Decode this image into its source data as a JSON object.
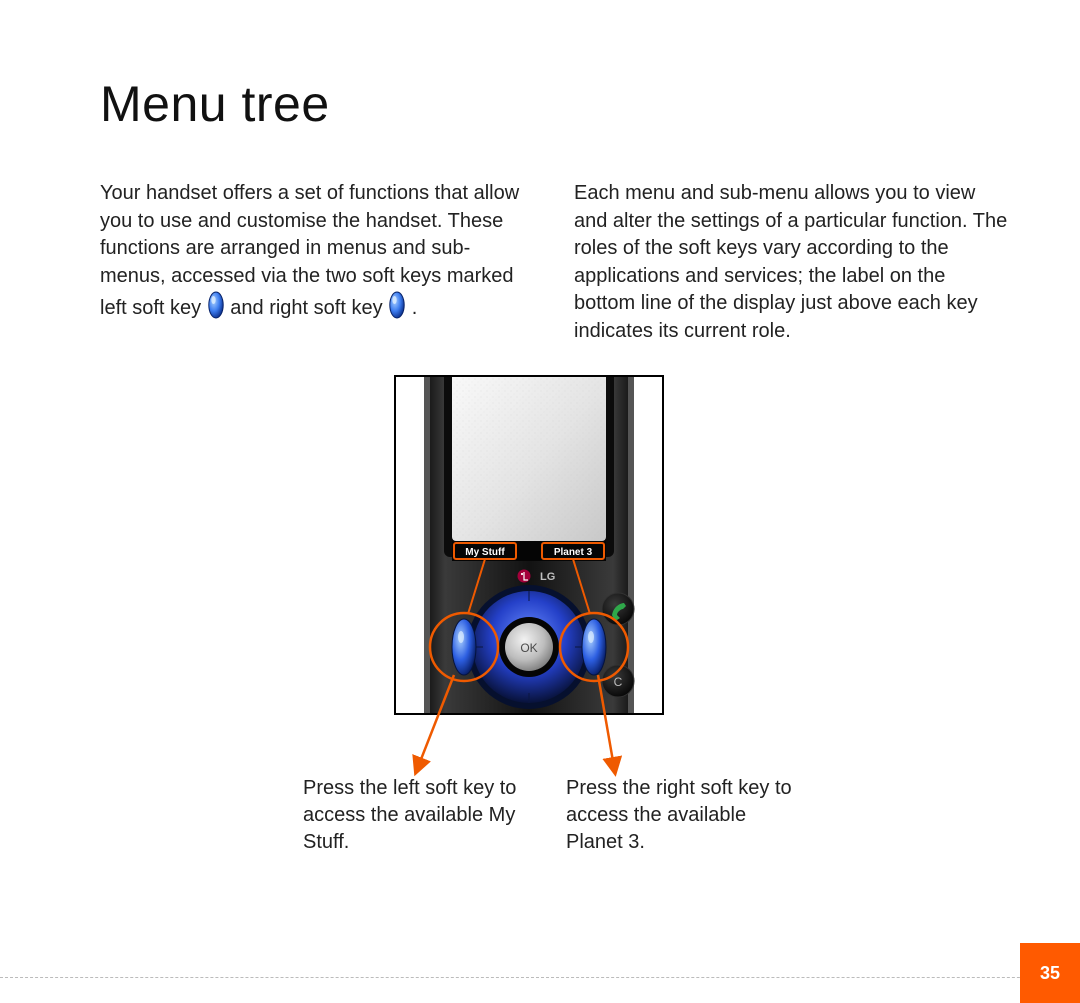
{
  "heading": "Menu tree",
  "paragraphs": {
    "left_pre": "Your handset offers a set of functions that allow you to use and customise the handset. These functions are arranged in menus and sub-menus, accessed via the two soft keys marked left soft key ",
    "left_mid": " and right soft key ",
    "left_post": " .",
    "right": "Each menu and sub-menu allows you to view and alter the settings of a particular function. The roles of the soft keys vary according to the applications and services; the label on the bottom line of the display just above each key indicates its current role."
  },
  "phone": {
    "brand": "LG",
    "soft_labels": {
      "left": "My Stuff",
      "right": "Planet 3"
    }
  },
  "captions": {
    "left": "Press the left soft key to access the available My Stuff.",
    "right": "Press the right soft key to access the available Planet 3."
  },
  "page_number": "35",
  "colors": {
    "accent": "#ff5a00",
    "key_blue_light": "#5aa5ff",
    "key_blue_dark": "#0b3fb0",
    "phone_dark": "#1a1a1a",
    "nav_ring": "#2a4cd8",
    "nav_ring_outer": "#09184a",
    "nav_center_light": "#e8e8e8",
    "nav_center_dark": "#8a8a8a",
    "call_green": "#2fa84a",
    "end_red": "#b02020"
  }
}
